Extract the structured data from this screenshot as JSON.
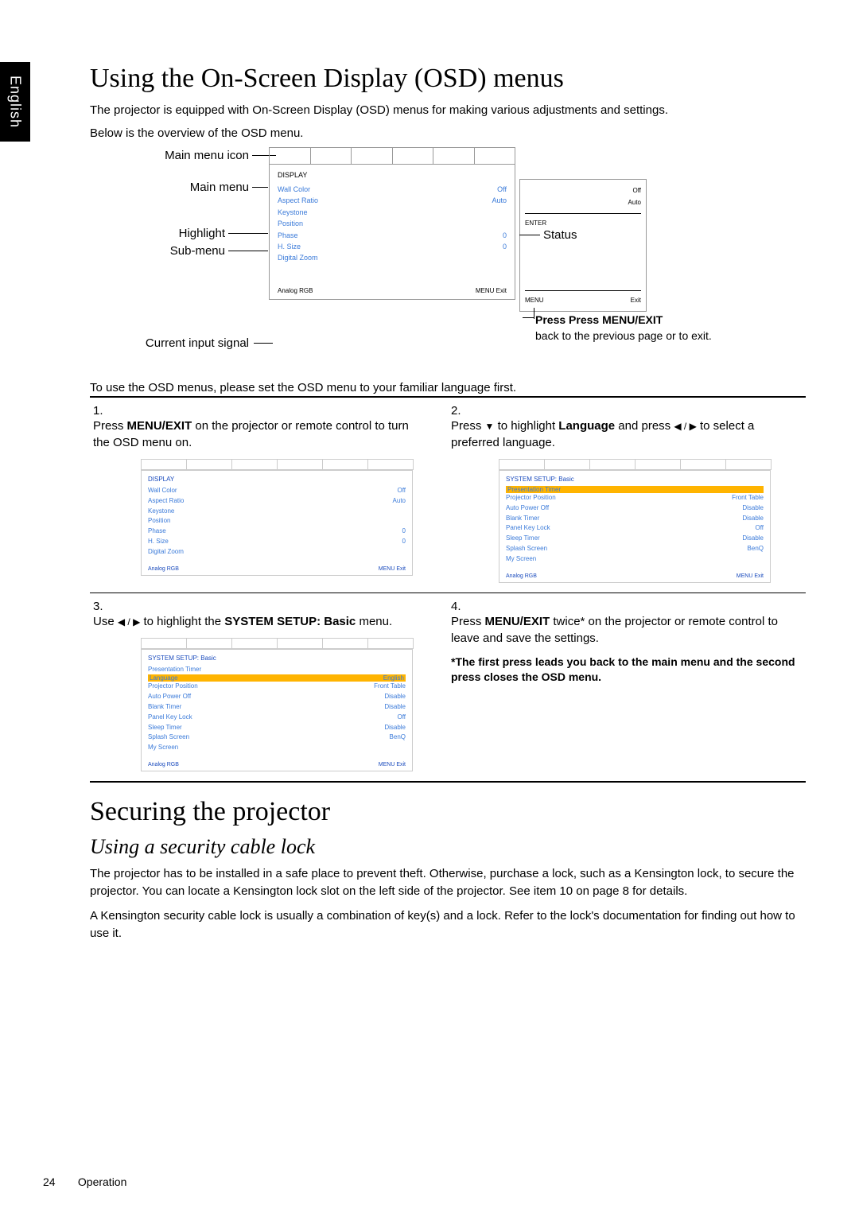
{
  "sidebar_lang": "English",
  "h1_osd": "Using the On-Screen Display (OSD) menus",
  "intro_1": "The projector is equipped with On-Screen Display (OSD) menus for making various adjustments and settings.",
  "intro_2": "Below is the overview of the OSD menu.",
  "labels": {
    "main_icon": "Main menu icon",
    "main_menu": "Main menu",
    "highlight": "Highlight",
    "sub_menu": "Sub-menu",
    "current_input": "Current input signal",
    "status": "Status",
    "press_menu": "Press MENU/EXIT",
    "press_back": "back to the previous page or to exit."
  },
  "overview_panel": {
    "title": "DISPLAY",
    "rows": [
      {
        "k": "Wall Color",
        "v": "Off"
      },
      {
        "k": "Aspect Ratio",
        "v": "Auto"
      },
      {
        "k": "Keystone",
        "v": ""
      },
      {
        "k": "Position",
        "v": ""
      },
      {
        "k": "Phase",
        "v": "0"
      },
      {
        "k": "H. Size",
        "v": "0"
      },
      {
        "k": "Digital Zoom",
        "v": ""
      }
    ],
    "footer_left": "Analog RGB",
    "footer_right": "MENU   Exit"
  },
  "side_panel": {
    "rows": [
      {
        "k": "",
        "v": "Off"
      },
      {
        "k": "",
        "v": "Auto"
      },
      {
        "k": "ENTER",
        "v": ""
      }
    ],
    "footer_left": "MENU",
    "footer_right": "Exit"
  },
  "instr": "To use the OSD menus, please set the OSD menu to your familiar language first.",
  "steps": {
    "s1": {
      "num": "1.",
      "text_a": "Press ",
      "bold": "MENU/EXIT",
      "text_b": " on the projector or remote control to turn the OSD menu on."
    },
    "s2": {
      "num": "2.",
      "text_a": "Press ",
      "sym": "▼",
      "text_b": " to highlight ",
      "bold": "Language",
      "text_c": " and press ",
      "sym2": "◀ / ▶",
      "text_d": " to select a preferred language."
    },
    "s3": {
      "num": "3.",
      "text_a": "Use ",
      "sym": "◀ / ▶",
      "text_b": " to highlight the ",
      "bold": "SYSTEM SETUP: Basic",
      "text_c": " menu."
    },
    "s4": {
      "num": "4.",
      "text_a": "Press ",
      "bold": "MENU/EXIT",
      "text_b": " twice* on the projector or remote control to leave and save the settings."
    },
    "note": "*The first press leads you back to the main menu and the second press closes the OSD menu."
  },
  "mini_display": {
    "title": "DISPLAY",
    "rows": [
      {
        "k": "Wall Color",
        "v": "Off"
      },
      {
        "k": "Aspect Ratio",
        "v": "Auto"
      },
      {
        "k": "Keystone",
        "v": ""
      },
      {
        "k": "Position",
        "v": ""
      },
      {
        "k": "Phase",
        "v": "0"
      },
      {
        "k": "H. Size",
        "v": "0"
      },
      {
        "k": "Digital Zoom",
        "v": ""
      }
    ],
    "footer_left": "Analog RGB",
    "footer_right": "MENU   Exit"
  },
  "mini_sys1": {
    "title": "SYSTEM SETUP: Basic",
    "highlight": {
      "k": "Presentation Timer",
      "v": ""
    },
    "rows": [
      {
        "k": "Projector Position",
        "v": "Front Table"
      },
      {
        "k": "Auto Power Off",
        "v": "Disable"
      },
      {
        "k": "Blank Timer",
        "v": "Disable"
      },
      {
        "k": "Panel Key Lock",
        "v": "Off"
      },
      {
        "k": "Sleep Timer",
        "v": "Disable"
      },
      {
        "k": "Splash Screen",
        "v": "BenQ"
      },
      {
        "k": "My Screen",
        "v": ""
      }
    ],
    "footer_left": "Analog RGB",
    "footer_right": "MENU   Exit"
  },
  "mini_sys2": {
    "title": "SYSTEM SETUP: Basic",
    "rows": [
      {
        "k": "Presentation Timer",
        "v": ""
      },
      {
        "k": "Language",
        "v": "English",
        "hl": true
      },
      {
        "k": "Projector Position",
        "v": "Front Table"
      },
      {
        "k": "Auto Power Off",
        "v": "Disable"
      },
      {
        "k": "Blank Timer",
        "v": "Disable"
      },
      {
        "k": "Panel Key Lock",
        "v": "Off"
      },
      {
        "k": "Sleep Timer",
        "v": "Disable"
      },
      {
        "k": "Splash Screen",
        "v": "BenQ"
      },
      {
        "k": "My Screen",
        "v": ""
      }
    ],
    "footer_left": "Analog RGB",
    "footer_right": "MENU   Exit"
  },
  "h1_secure": "Securing the projector",
  "h2_lock": "Using a security cable lock",
  "secure_p1": "The projector has to be installed in a safe place to prevent theft. Otherwise, purchase a lock, such as a Kensington lock, to secure the projector. You can locate a Kensington lock slot on the left side of the projector. See item 10 on page 8 for details.",
  "secure_p2": "A Kensington security cable lock is usually a combination of key(s) and a lock. Refer to the lock's documentation for finding out how to use it.",
  "footer": {
    "page": "24",
    "section": "Operation"
  }
}
